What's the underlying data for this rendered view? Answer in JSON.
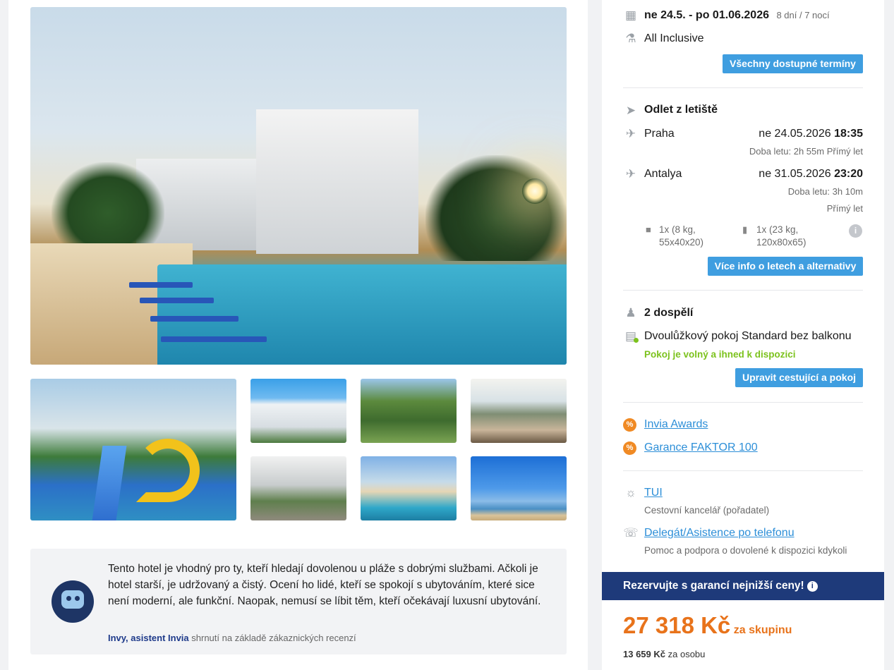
{
  "gallery": {
    "main_photo_alt": "hotel-pool",
    "thumbnails": [
      "waterslide",
      "hotel-building",
      "playground",
      "restaurant",
      "hotel-entrance",
      "pool-sunset",
      "beach-sea"
    ]
  },
  "summary": {
    "text": "Tento hotel je vhodný pro ty, kteří hledají dovolenou u pláže s dobrými službami. Ačkoli je hotel starší, je udržovaný a čistý. Ocení ho lidé, kteří se spokojí s ubytováním, které sice není moderní, ale funkční. Naopak, nemusí se líbit těm, kteří očekávají luxusní ubytování.",
    "assistant_name": "Invy, asistent Invia",
    "assistant_suffix": "shrnutí na základě zákaznických recenzí"
  },
  "booking": {
    "dates": "ne 24.5. - po 01.06.2026",
    "duration": "8 dní / 7 nocí",
    "board": "All Inclusive",
    "all_dates_button": "Všechny dostupné termíny",
    "flight_header": "Odlet z letiště",
    "outbound": {
      "city": "Praha",
      "date": "ne 24.05.2026",
      "time": "18:35",
      "detail": "Doba letu: 2h 55m  Přímý let"
    },
    "inbound": {
      "city": "Antalya",
      "date": "ne 31.05.2026",
      "time": "23:20",
      "detail1": "Doba letu: 3h 10m",
      "detail2": "Přímý let"
    },
    "cabin_bag": {
      "line1": "1x (8 kg,",
      "line2": "55x40x20)"
    },
    "hold_bag": {
      "line1": "1x (23 kg,",
      "line2": "120x80x65)"
    },
    "flight_info_button": "Více info o letech a alternativy",
    "travellers": "2 dospělí",
    "room": "Dvoulůžkový pokoj Standard bez balkonu",
    "room_status": "Pokoj je volný a ihned k dispozici",
    "edit_button": "Upravit cestující a pokoj",
    "awards_link": "Invia Awards",
    "guarantee_link": "Garance FAKTOR 100",
    "operator_link": "TUI",
    "operator_desc": "Cestovní kancelář (pořadatel)",
    "delegate_link": "Delegát/Asistence po telefonu",
    "delegate_desc": "Pomoc a podpora o dovolené k dispozici kdykoli",
    "banner": "Rezervujte s garancí nejnižší ceny!",
    "price": "27 318 Kč",
    "price_suffix": "za skupinu",
    "per_person_value": "13 659 Kč",
    "per_person_suffix": "za osobu"
  },
  "colors": {
    "accent": "#3f9ee0",
    "price": "#e8731b",
    "banner": "#1e3a7a",
    "available": "#7cc21d"
  }
}
